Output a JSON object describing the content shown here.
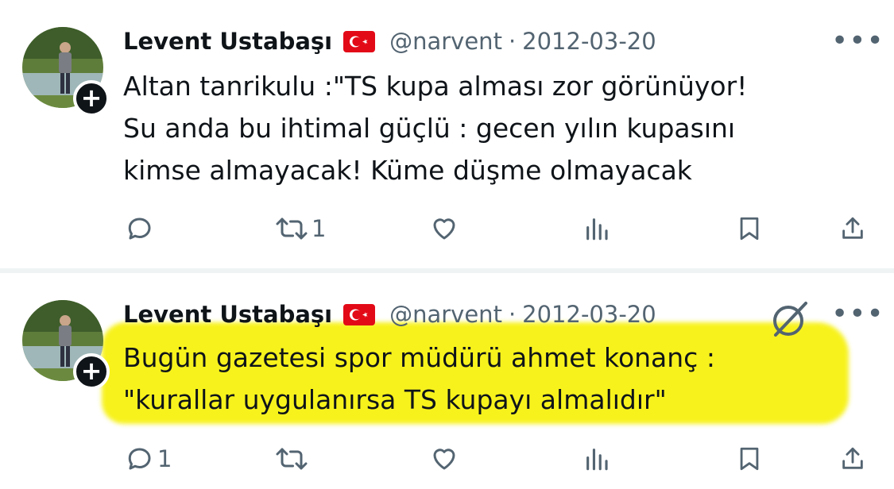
{
  "tweets": [
    {
      "author": {
        "name": "Levent Ustabaşı",
        "handle": "@narvent"
      },
      "separator": "·",
      "date": "2012-03-20",
      "text_lines": [
        "Altan tanrikulu :\"TS kupa alması zor görünüyor!",
        "Su anda bu ihtimal güçlü : gecen yılın kupasını",
        "kimse almayacak! Küme düşme olmayacak"
      ],
      "highlighted": false,
      "actions": {
        "reply_count": "",
        "retweet_count": "1"
      }
    },
    {
      "author": {
        "name": "Levent Ustabaşı",
        "handle": "@narvent"
      },
      "separator": "·",
      "date": "2012-03-20",
      "text_lines": [
        "Bugün gazetesi spor müdürü ahmet konanç :",
        "\"kurallar uygulanırsa TS kupayı almalıdır\""
      ],
      "highlighted": true,
      "highlight_color": "#f7f21c",
      "actions": {
        "reply_count": "1",
        "retweet_count": ""
      }
    }
  ],
  "icons": {
    "flag": "turkey-flag-icon",
    "more": "more-options-icon",
    "reply": "reply-icon",
    "retweet": "retweet-icon",
    "like": "like-icon",
    "views": "views-icon",
    "bookmark": "bookmark-icon",
    "share": "share-icon",
    "grok": "grok-icon",
    "follow": "follow-plus-icon"
  },
  "glyphs": {
    "more": "•••",
    "plus": "+"
  },
  "colors": {
    "primary_text": "#0f1419",
    "secondary_text": "#536471",
    "divider": "#eff3f4",
    "flag_red": "#e30a17"
  }
}
